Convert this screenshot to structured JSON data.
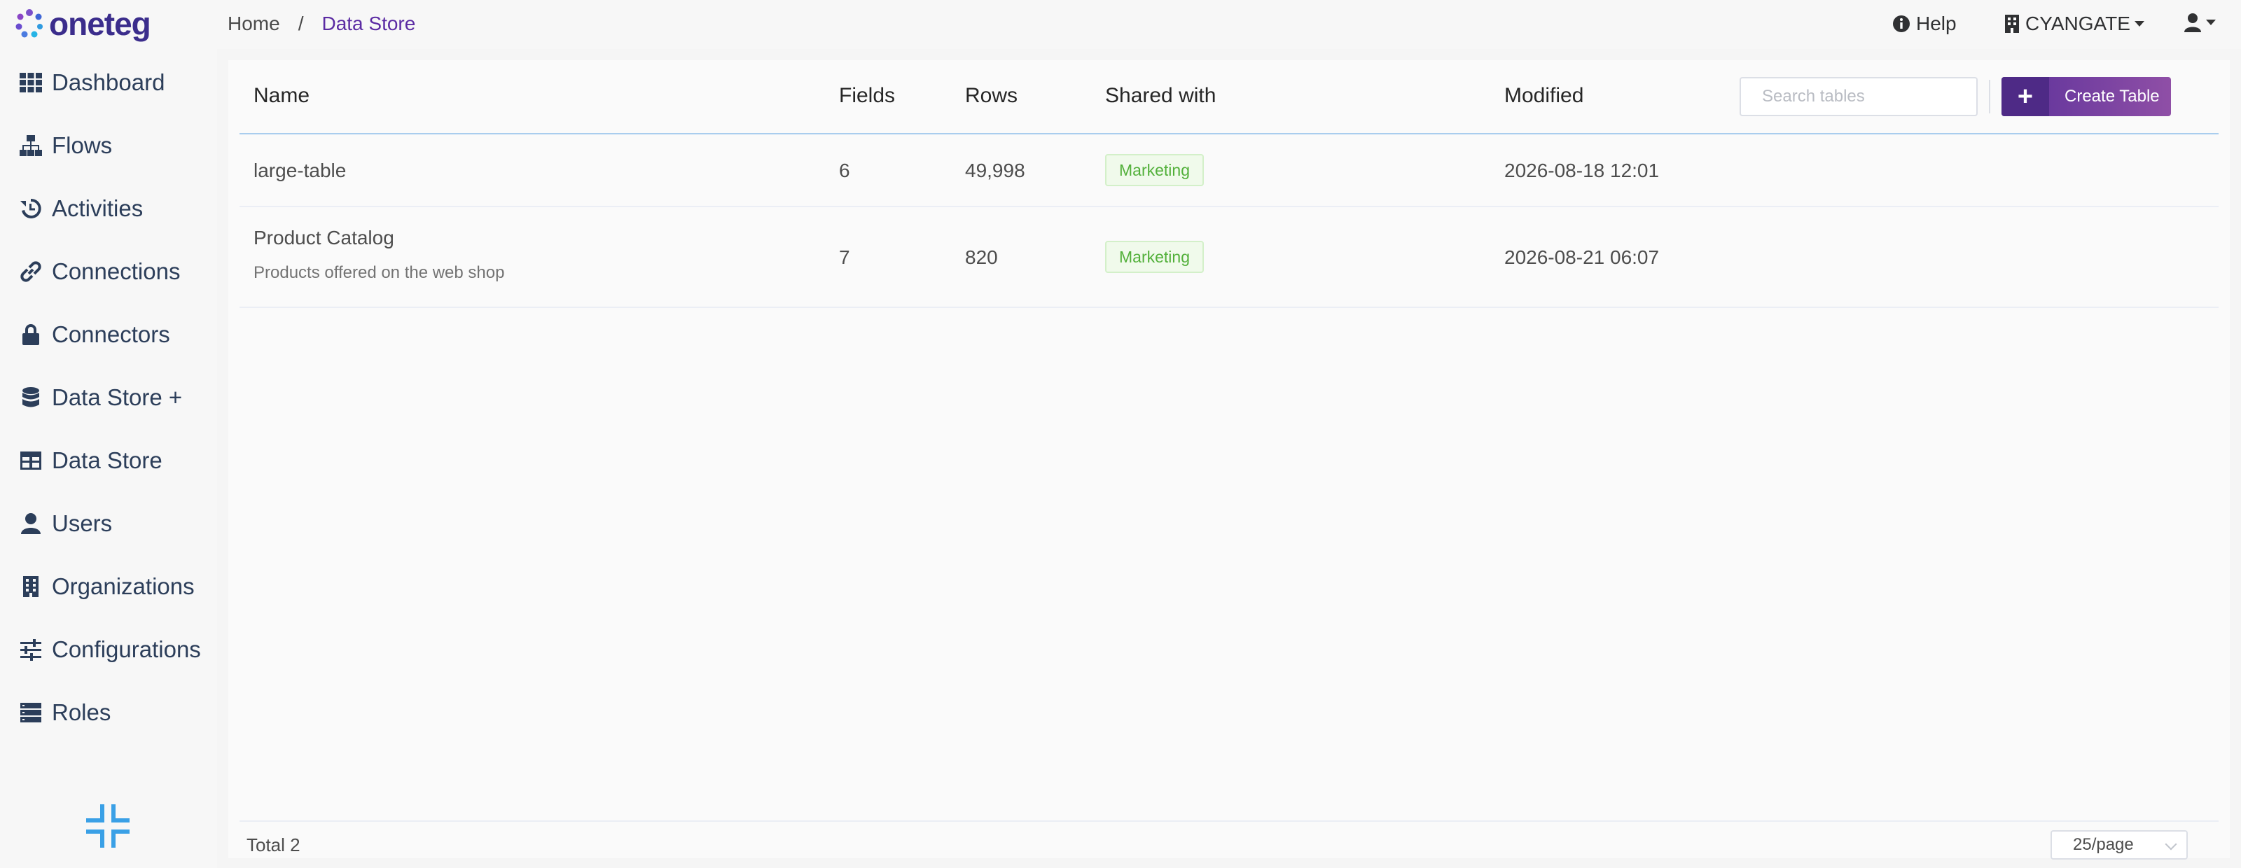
{
  "app": {
    "brand": "oneteg"
  },
  "breadcrumb": {
    "home": "Home",
    "separator": "/",
    "current": "Data Store"
  },
  "topbar": {
    "help": "Help",
    "org": "CYANGATE"
  },
  "sidebar": {
    "items": [
      {
        "label": "Dashboard",
        "icon": "grid-icon"
      },
      {
        "label": "Flows",
        "icon": "sitemap-icon"
      },
      {
        "label": "Activities",
        "icon": "history-icon"
      },
      {
        "label": "Connections",
        "icon": "link-icon"
      },
      {
        "label": "Connectors",
        "icon": "lock-icon"
      },
      {
        "label": "Data Store +",
        "icon": "database-icon"
      },
      {
        "label": "Data Store",
        "icon": "table-icon"
      },
      {
        "label": "Users",
        "icon": "user-icon"
      },
      {
        "label": "Organizations",
        "icon": "building-icon"
      },
      {
        "label": "Configurations",
        "icon": "sliders-icon"
      },
      {
        "label": "Roles",
        "icon": "list-icon"
      }
    ]
  },
  "table": {
    "columns": {
      "name": "Name",
      "fields": "Fields",
      "rows": "Rows",
      "shared": "Shared with",
      "modified": "Modified"
    },
    "search_placeholder": "Search tables",
    "create_label": "Create Table",
    "rows": [
      {
        "name": "large-table",
        "description": "",
        "fields": "6",
        "rows": "49,998",
        "shared": "Marketing",
        "modified": "2026-08-18 12:01"
      },
      {
        "name": "Product Catalog",
        "description": "Products offered on the web shop",
        "fields": "7",
        "rows": "820",
        "shared": "Marketing",
        "modified": "2026-08-21 06:07"
      }
    ]
  },
  "footer": {
    "total": "Total 2",
    "page_size": "25/page"
  },
  "colors": {
    "brand": "#3b2d8c",
    "accent": "#5b2ba3",
    "tag_green": "#52b03a",
    "nav_text": "#2c3e5a"
  }
}
